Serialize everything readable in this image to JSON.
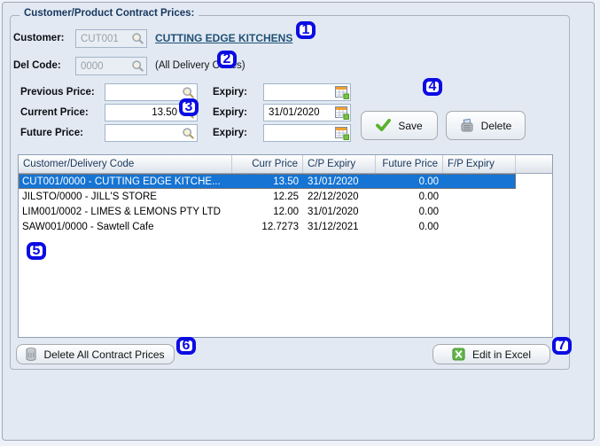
{
  "window": {
    "title": "Customer/Product Contract Prices:"
  },
  "form": {
    "customer": {
      "label": "Customer:",
      "value": "CUT001",
      "name_link": "CUTTING EDGE KITCHENS"
    },
    "del_code": {
      "label": "Del Code:",
      "value": "0000",
      "description": "(All Delivery Codes)"
    },
    "previous_price": {
      "label": "Previous Price:",
      "value": "",
      "expiry_label": "Expiry:",
      "expiry_value": ""
    },
    "current_price": {
      "label": "Current Price:",
      "value": "13.50",
      "expiry_label": "Expiry:",
      "expiry_value": "31/01/2020"
    },
    "future_price": {
      "label": "Future Price:",
      "value": "",
      "expiry_label": "Expiry:",
      "expiry_value": ""
    },
    "save_button": "Save",
    "delete_button": "Delete"
  },
  "table": {
    "columns": [
      "Customer/Delivery Code",
      "Curr Price",
      "C/P Expiry",
      "Future Price",
      "F/P Expiry"
    ],
    "rows": [
      {
        "code": "CUT001/0000 - CUTTING EDGE KITCHE...",
        "curr_price": "13.50",
        "cp_expiry": "31/01/2020",
        "future_price": "0.00",
        "fp_expiry": "",
        "selected": true
      },
      {
        "code": "JILSTO/0000 - JILL'S STORE",
        "curr_price": "12.25",
        "cp_expiry": "22/12/2020",
        "future_price": "0.00",
        "fp_expiry": "",
        "selected": false
      },
      {
        "code": "LIM001/0002 - LIMES & LEMONS PTY LTD",
        "curr_price": "12.00",
        "cp_expiry": "31/01/2020",
        "future_price": "0.00",
        "fp_expiry": "",
        "selected": false
      },
      {
        "code": "SAW001/0000 - Sawtell Cafe",
        "curr_price": "12.7273",
        "cp_expiry": "31/12/2021",
        "future_price": "0.00",
        "fp_expiry": "",
        "selected": false
      }
    ]
  },
  "footer": {
    "delete_all_button": "Delete All Contract Prices",
    "edit_excel_button": "Edit in Excel"
  },
  "annotations": {
    "m1": "1",
    "m2": "2",
    "m3": "3",
    "m4": "4",
    "m5": "5",
    "m6": "6",
    "m7": "7"
  },
  "icons": {
    "lookup": "magnifier-icon",
    "expiry": "calendar-icon",
    "save": "green-check-icon",
    "delete": "shredder-icon",
    "delete_all": "trash-bin-icon",
    "excel": "excel-icon"
  },
  "colors": {
    "background": "#e2e9f2",
    "selection_blue": "#1574d4",
    "annotation_blue": "#0b0be4",
    "link_blue": "#1f5177",
    "header_text": "#17375e",
    "excel_green": "#64b54a",
    "check_green": "#58b32c"
  }
}
